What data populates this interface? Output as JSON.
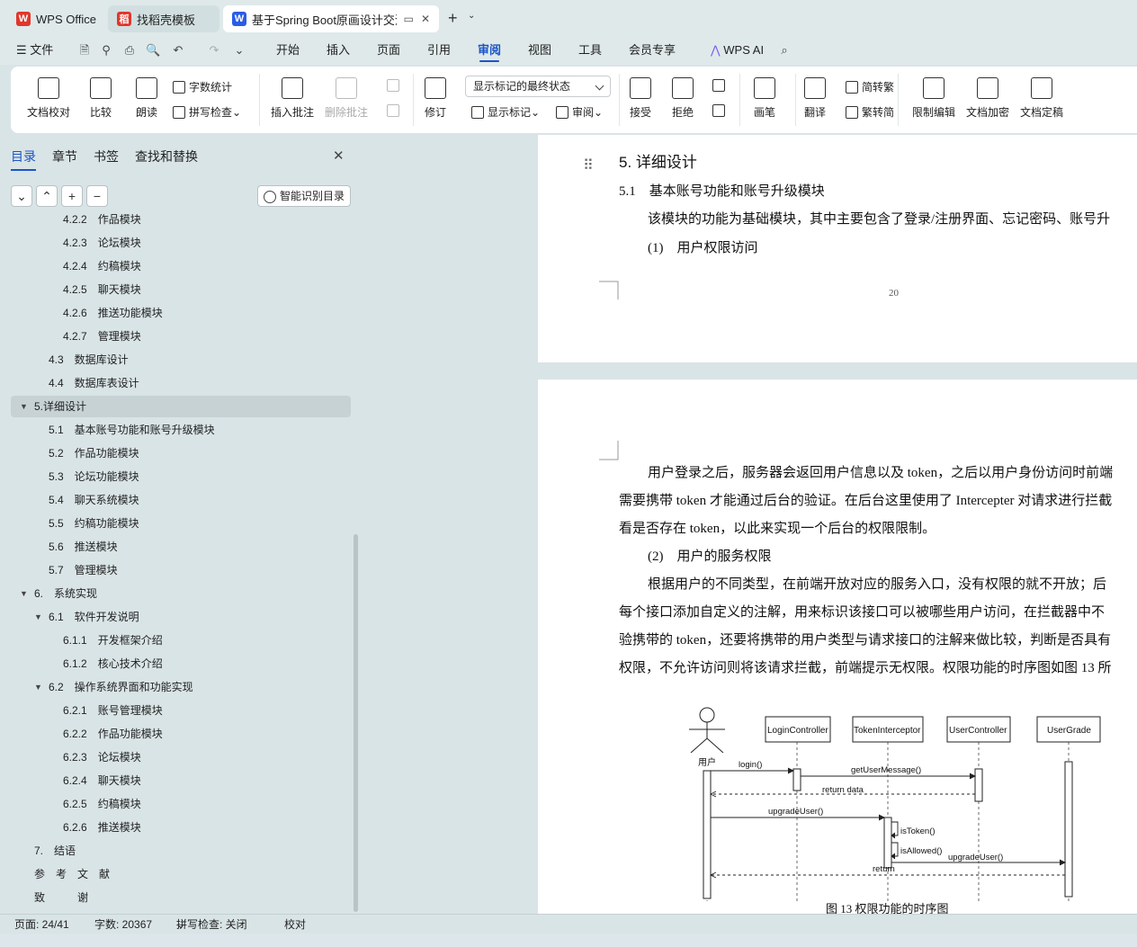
{
  "tabs": [
    {
      "label": "WPS Office",
      "logo": "W",
      "logo_color": "#e0362c"
    },
    {
      "label": "找稻壳模板",
      "logo": "稻",
      "logo_color": "#e0362c"
    },
    {
      "label": "基于Spring Boot原画设计交流",
      "logo": "W",
      "logo_color": "#2b5ce6"
    }
  ],
  "menu": {
    "file": "文件",
    "items": [
      "开始",
      "插入",
      "页面",
      "引用",
      "审阅",
      "视图",
      "工具",
      "会员专享"
    ],
    "active": "审阅",
    "ai": "WPS AI"
  },
  "ribbon": {
    "doc_proof": "文档校对",
    "compare": "比较",
    "read_aloud": "朗读",
    "word_count": "字数统计",
    "spell_check": "拼写检查",
    "insert_comment": "插入批注",
    "delete_comment": "删除批注",
    "revise": "修订",
    "markup_dropdown": "显示标记的最终状态",
    "show_markup": "显示标记",
    "review": "审阅",
    "accept": "接受",
    "reject": "拒绝",
    "pen": "画笔",
    "translate": "翻译",
    "to_traditional": "简转繁",
    "to_simplified": "繁转简",
    "restrict_edit": "限制编辑",
    "encrypt": "文档加密",
    "finalize": "文档定稿"
  },
  "sidebar": {
    "tabs": [
      "目录",
      "章节",
      "书签",
      "查找和替换"
    ],
    "smart_btn": "智能识别目录",
    "toc": [
      {
        "text": "4.2.2　作品模块",
        "level": 3
      },
      {
        "text": "4.2.3　论坛模块",
        "level": 3
      },
      {
        "text": "4.2.4　约稿模块",
        "level": 3
      },
      {
        "text": "4.2.5　聊天模块",
        "level": 3
      },
      {
        "text": "4.2.6　推送功能模块",
        "level": 3
      },
      {
        "text": "4.2.7　管理模块",
        "level": 3
      },
      {
        "text": "4.3　数据库设计",
        "level": 2
      },
      {
        "text": "4.4　数据库表设计",
        "level": 2
      },
      {
        "text": "5.详细设计",
        "level": 1,
        "selected": true,
        "expanded": true
      },
      {
        "text": "5.1　基本账号功能和账号升级模块",
        "level": 2
      },
      {
        "text": "5.2　作品功能模块",
        "level": 2
      },
      {
        "text": "5.3　论坛功能模块",
        "level": 2
      },
      {
        "text": "5.4　聊天系统模块",
        "level": 2
      },
      {
        "text": "5.5　约稿功能模块",
        "level": 2
      },
      {
        "text": "5.6　推送模块",
        "level": 2
      },
      {
        "text": "5.7　管理模块",
        "level": 2
      },
      {
        "text": "6.　系统实现",
        "level": 1,
        "expanded": true
      },
      {
        "text": "6.1　软件开发说明",
        "level": 2,
        "expanded": true
      },
      {
        "text": "6.1.1　开发框架介绍",
        "level": 3
      },
      {
        "text": "6.1.2　核心技术介绍",
        "level": 3
      },
      {
        "text": "6.2　操作系统界面和功能实现",
        "level": 2,
        "expanded": true
      },
      {
        "text": "6.2.1　账号管理模块",
        "level": 3
      },
      {
        "text": "6.2.2　作品功能模块",
        "level": 3
      },
      {
        "text": "6.2.3　论坛模块",
        "level": 3
      },
      {
        "text": "6.2.4　聊天模块",
        "level": 3
      },
      {
        "text": "6.2.5　约稿模块",
        "level": 3
      },
      {
        "text": "6.2.6　推送模块",
        "level": 3
      },
      {
        "text": "7.　结语",
        "level": 1
      },
      {
        "text": "参　考　文　献",
        "level": 1
      },
      {
        "text": "致　　　谢",
        "level": 1
      }
    ]
  },
  "doc": {
    "heading1": "5. 详细设计",
    "heading2": "5.1　基本账号功能和账号升级模块",
    "p1": "该模块的功能为基础模块，其中主要包含了登录/注册界面、忘记密码、账号升",
    "item1": "(1)　用户权限访问",
    "page_num": "20",
    "p2_lines": [
      "用户登录之后，服务器会返回用户信息以及 token，之后以用户身份访问时前端",
      "需要携带 token 才能通过后台的验证。在后台这里使用了 Intercepter 对请求进行拦截",
      "看是否存在 token，以此来实现一个后台的权限限制。"
    ],
    "item2": "(2)　用户的服务权限",
    "p3_lines": [
      "根据用户的不同类型，在前端开放对应的服务入口，没有权限的就不开放；后",
      "每个接口添加自定义的注解，用来标识该接口可以被哪些用户访问，在拦截器中不",
      "验携带的 token，还要将携带的用户类型与请求接口的注解来做比较，判断是否具有",
      "权限，不允许访问则将该请求拦截，前端提示无权限。权限功能的时序图如图 13 所"
    ],
    "diagram": {
      "actor": "用户",
      "lifelines": [
        "LoginController",
        "TokenInterceptor",
        "UserController",
        "UserGrade"
      ],
      "messages": [
        "login()",
        "getUserMessage()",
        "return data",
        "upgradeUser()",
        "isToken()",
        "isAllowed()",
        "upgradeUser()",
        "return"
      ]
    },
    "caption": "图 13  权限功能的时序图"
  },
  "status": {
    "page": "页面: 24/41",
    "words": "字数: 20367",
    "spell": "拼写检查: 关闭",
    "proof": "校对"
  }
}
